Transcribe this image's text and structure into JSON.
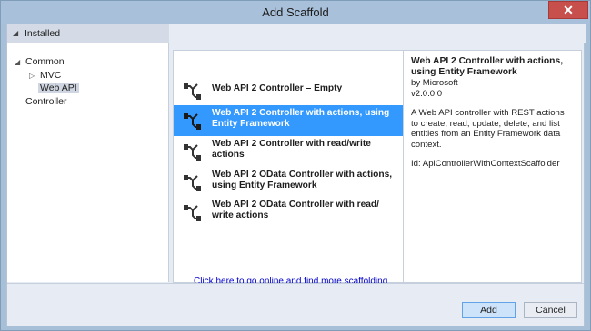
{
  "window": {
    "title": "Add Scaffold",
    "close_glyph": "✕"
  },
  "sidebar": {
    "installed_label": "Installed",
    "collapse_glyph": "◢",
    "tree": [
      {
        "label": "Common",
        "arrow": "◢"
      },
      {
        "label": "MVC",
        "arrow": "▷"
      },
      {
        "label": "Web API",
        "arrow": "",
        "selected": true
      },
      {
        "label": "Controller",
        "arrow": ""
      }
    ]
  },
  "list": {
    "items": [
      {
        "label": "Web API 2 Controller – Empty",
        "icon": "controller-icon"
      },
      {
        "label": "Web API 2 Controller with actions, using Entity Framework",
        "icon": "controller-icon",
        "selected": true
      },
      {
        "label": "Web API 2 Controller with read/write actions",
        "icon": "controller-icon"
      },
      {
        "label": "Web API 2 OData Controller with actions, using Entity Framework",
        "icon": "controller-icon"
      },
      {
        "label": "Web API 2 OData Controller with read/ write actions",
        "icon": "controller-icon"
      }
    ],
    "online_link": "Click here to go online and find more scaffolding extensions."
  },
  "details": {
    "title": "Web API 2 Controller with actions, using Entity Framework",
    "author": "by Microsoft",
    "version": "v2.0.0.0",
    "description": "A Web API controller with REST actions to create, read, update, delete, and list entities from an Entity Framework data context.",
    "id": "Id: ApiControllerWithContextScaffolder"
  },
  "buttons": {
    "add": "Add",
    "cancel": "Cancel"
  },
  "colors": {
    "selection": "#3399ff",
    "title_bar": "#a8c0da",
    "close": "#c7504d"
  }
}
